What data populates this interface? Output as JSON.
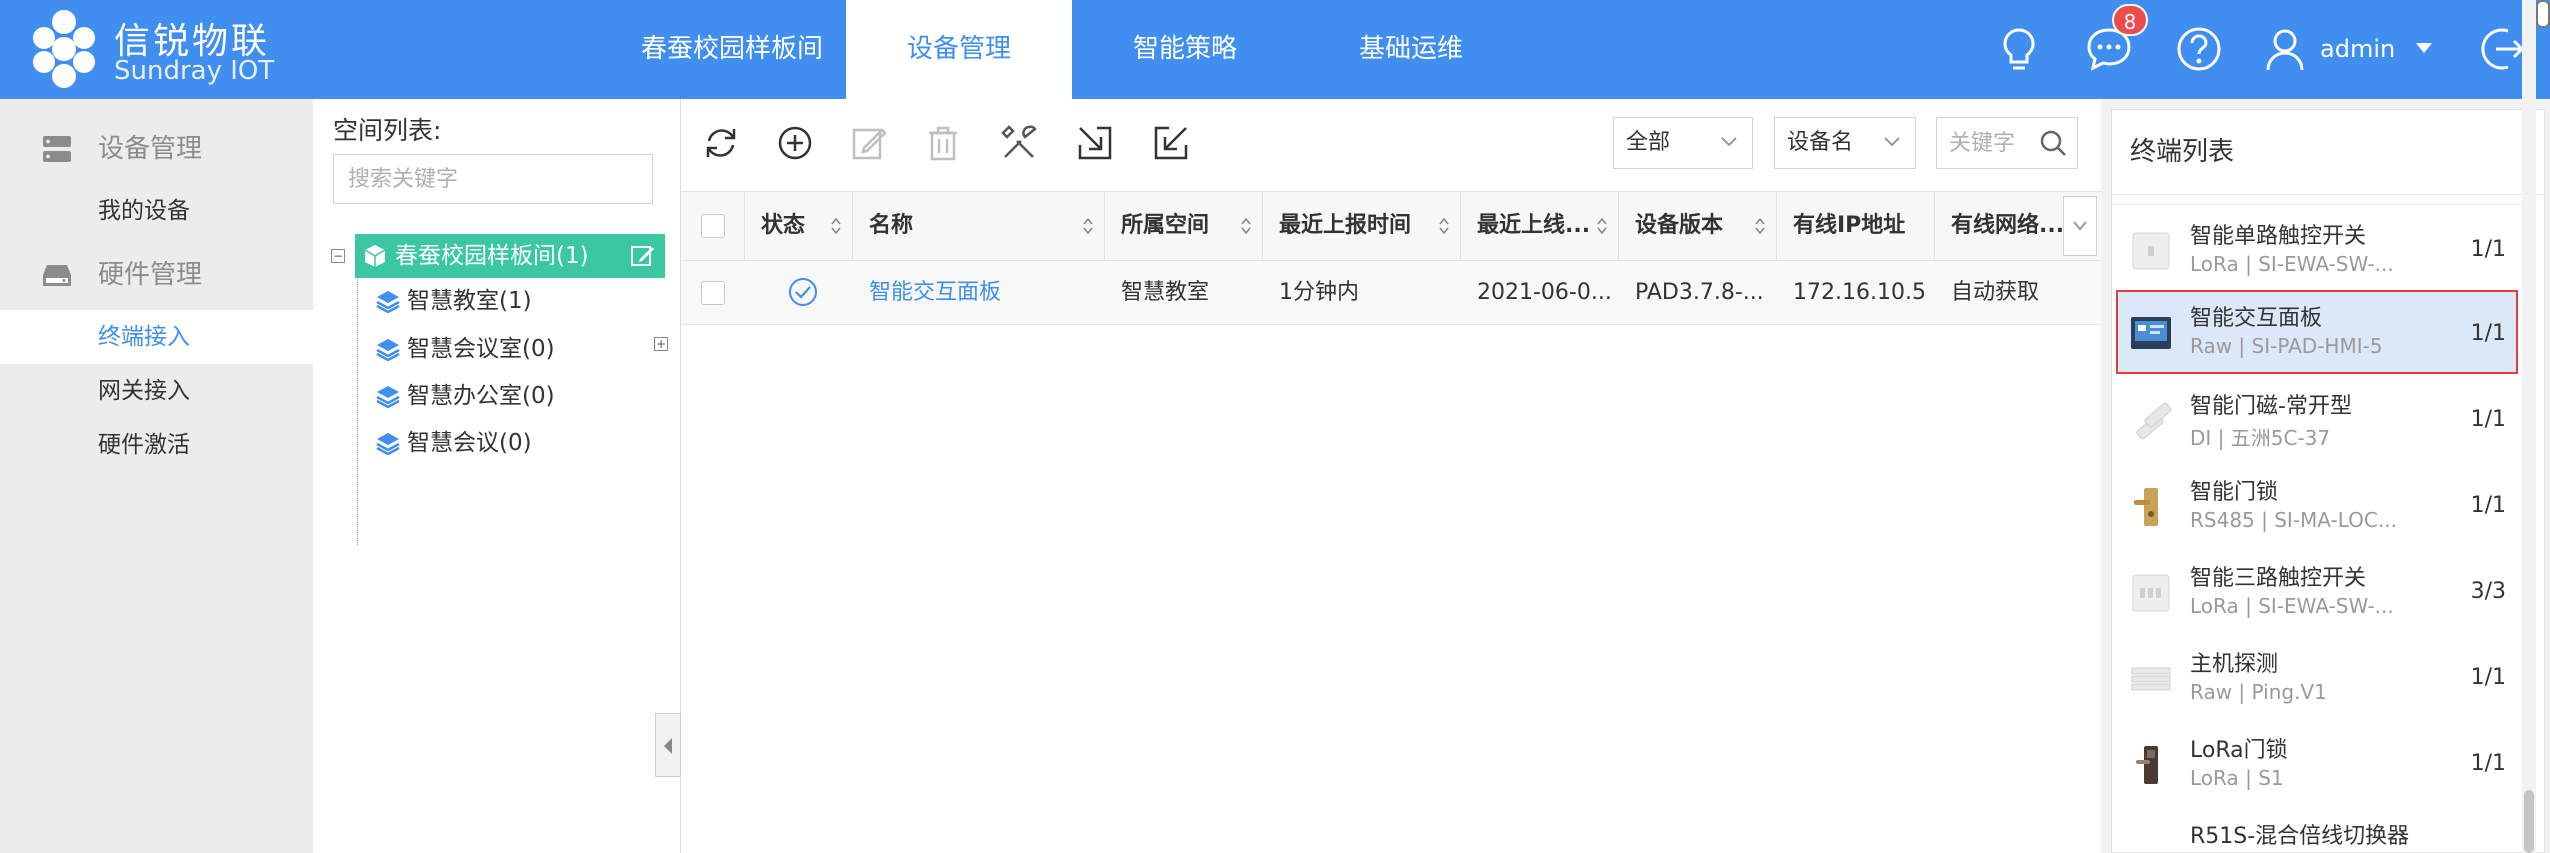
{
  "brand": {
    "name_cn": "信锐物联",
    "name_en": "Sundray IOT"
  },
  "top_nav": {
    "tabs": [
      {
        "label": "春蚕校园样板间"
      },
      {
        "label": "设备管理"
      },
      {
        "label": "智能策略"
      },
      {
        "label": "基础运维"
      }
    ],
    "active_tab": "设备管理",
    "message_badge": "8",
    "user": "admin",
    "icons": [
      "bulb-icon",
      "message-icon",
      "help-icon",
      "user-icon",
      "chevron-down-icon",
      "logout-icon"
    ]
  },
  "left_nav": {
    "groups": [
      {
        "label": "设备管理",
        "icon": "server-icon",
        "items": [
          {
            "label": "我的设备"
          }
        ]
      },
      {
        "label": "硬件管理",
        "icon": "hardware-icon",
        "items": [
          {
            "label": "终端接入"
          },
          {
            "label": "网关接入"
          },
          {
            "label": "硬件激活"
          }
        ]
      }
    ],
    "active_item": "终端接入"
  },
  "space_tree": {
    "title": "空间列表:",
    "search_placeholder": "搜索关键字",
    "root": {
      "label": "春蚕校园样板间(1)"
    },
    "children": [
      {
        "label": "智慧教室(1)"
      },
      {
        "label": "智慧会议室(0)"
      },
      {
        "label": "智慧办公室(0)"
      },
      {
        "label": "智慧会议(0)"
      }
    ]
  },
  "toolbar": {
    "icons": [
      "refresh-icon",
      "add-icon",
      "edit-icon",
      "delete-icon",
      "tools-icon",
      "import-icon",
      "export-icon"
    ],
    "filter_scope": "全部",
    "filter_field": "设备名",
    "keyword_placeholder": "关键字"
  },
  "table": {
    "columns": [
      "状态",
      "名称",
      "所属空间",
      "最近上报时间",
      "最近上线...",
      "设备版本",
      "有线IP地址",
      "有线网络..."
    ],
    "rows": [
      {
        "status": "online",
        "name": "智能交互面板",
        "space": "智慧教室",
        "last_report": "1分钟内",
        "last_online": "2021-06-0...",
        "version": "PAD3.7.8-...",
        "ip": "172.16.10.5",
        "net": "自动获取"
      }
    ]
  },
  "terminal_list": {
    "title": "终端列表",
    "items": [
      {
        "name": "智能单路触控开关",
        "sub": "LoRa | SI-EWA-SW-...",
        "count": "1/1",
        "icon": "switch-thumb"
      },
      {
        "name": "智能交互面板",
        "sub": "Raw | SI-PAD-HMI-5",
        "count": "1/1",
        "icon": "panel-thumb",
        "selected": true
      },
      {
        "name": "智能门磁-常开型",
        "sub": "DI | 五洲5C-37",
        "count": "1/1",
        "icon": "door-sensor-thumb"
      },
      {
        "name": "智能门锁",
        "sub": "RS485 | SI-MA-LOC...",
        "count": "1/1",
        "icon": "door-lock-thumb"
      },
      {
        "name": "智能三路触控开关",
        "sub": "LoRa | SI-EWA-SW-...",
        "count": "3/3",
        "icon": "switch-thumb"
      },
      {
        "name": "主机探测",
        "sub": "Raw | Ping.V1",
        "count": "1/1",
        "icon": "host-thumb"
      },
      {
        "name": "LoRa门锁",
        "sub": "LoRa | S1",
        "count": "1/1",
        "icon": "lora-lock-thumb"
      },
      {
        "name": "R51S-混合倍线切换器",
        "sub": "",
        "count": "",
        "icon": ""
      }
    ]
  },
  "colors": {
    "primary": "#3f8ef0",
    "tree_active": "#3cc7a3",
    "selected_border": "#e23d3d",
    "badge": "#ef4b4b"
  }
}
